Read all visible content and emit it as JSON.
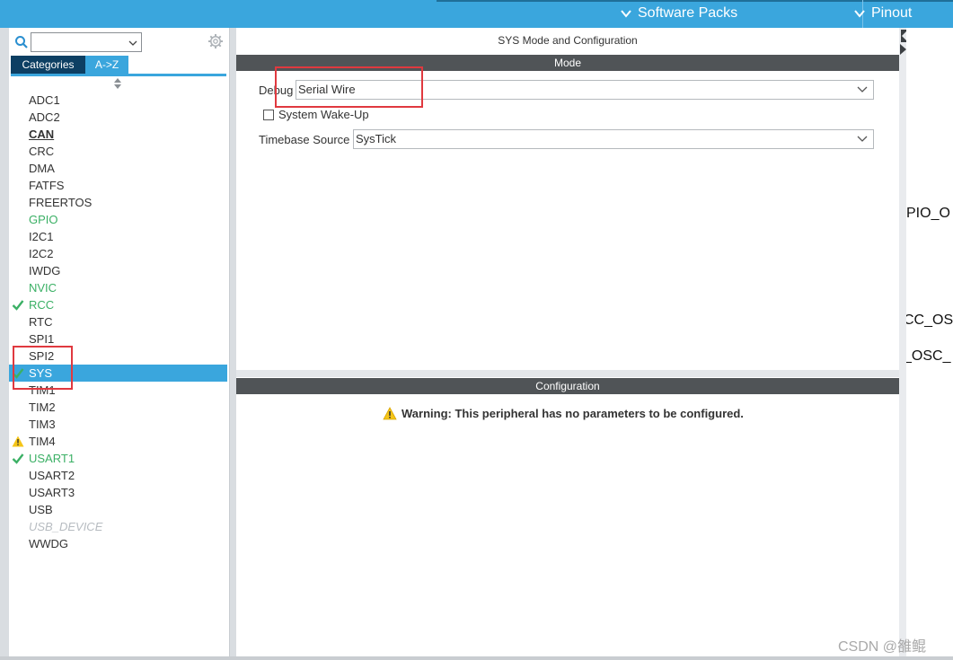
{
  "topbar": {
    "software_packs": "Software Packs",
    "pinout": "Pinout"
  },
  "left": {
    "search": {
      "value": ""
    },
    "tabs": {
      "categories": "Categories",
      "az": "A->Z"
    },
    "peripherals": [
      {
        "label": "ADC1",
        "style": "normal"
      },
      {
        "label": "ADC2",
        "style": "normal"
      },
      {
        "label": "CAN",
        "style": "bold"
      },
      {
        "label": "CRC",
        "style": "normal"
      },
      {
        "label": "DMA",
        "style": "normal"
      },
      {
        "label": "FATFS",
        "style": "normal"
      },
      {
        "label": "FREERTOS",
        "style": "normal"
      },
      {
        "label": "GPIO",
        "style": "green"
      },
      {
        "label": "I2C1",
        "style": "normal"
      },
      {
        "label": "I2C2",
        "style": "normal"
      },
      {
        "label": "IWDG",
        "style": "normal"
      },
      {
        "label": "NVIC",
        "style": "green"
      },
      {
        "label": "RCC",
        "style": "green",
        "status": "check"
      },
      {
        "label": "RTC",
        "style": "normal"
      },
      {
        "label": "SPI1",
        "style": "normal"
      },
      {
        "label": "SPI2",
        "style": "normal"
      },
      {
        "label": "SYS",
        "style": "selected",
        "status": "check"
      },
      {
        "label": "TIM1",
        "style": "normal"
      },
      {
        "label": "TIM2",
        "style": "normal"
      },
      {
        "label": "TIM3",
        "style": "normal"
      },
      {
        "label": "TIM4",
        "style": "normal",
        "status": "warning"
      },
      {
        "label": "USART1",
        "style": "green",
        "status": "check"
      },
      {
        "label": "USART2",
        "style": "normal"
      },
      {
        "label": "USART3",
        "style": "normal"
      },
      {
        "label": "USB",
        "style": "normal"
      },
      {
        "label": "USB_DEVICE",
        "style": "disabled"
      },
      {
        "label": "WWDG",
        "style": "normal"
      }
    ]
  },
  "center": {
    "title": "SYS Mode and Configuration",
    "mode_bar": "Mode",
    "debug": {
      "label": "Debug",
      "value": "Serial Wire"
    },
    "wakeup": {
      "label": "System Wake-Up",
      "checked": false
    },
    "timebase": {
      "label": "Timebase Source",
      "value": "SysTick"
    },
    "config_bar": "Configuration",
    "warning": "Warning: This peripheral has no parameters to be configured."
  },
  "right": {
    "pin_labels": [
      "PIO_O",
      "CC_OS",
      "_OSC_"
    ]
  },
  "watermark": "CSDN @雒鲲",
  "colors": {
    "accent": "#3aa6dd",
    "dark_tab": "#0d3f63",
    "green": "#3bb065",
    "bar": "#505457",
    "highlight_box": "#e0393f",
    "warning": "#f5c518"
  }
}
